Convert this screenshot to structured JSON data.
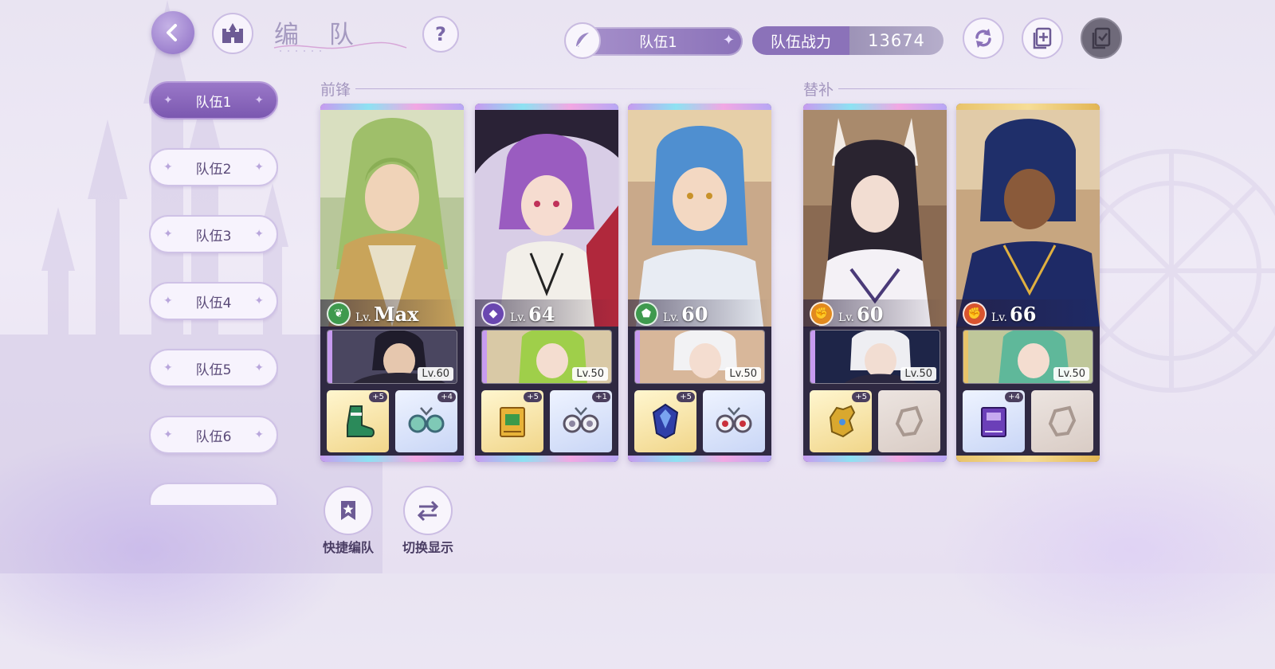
{
  "header": {
    "title": "编 队",
    "back_icon": "back-arrow-icon",
    "home_icon": "castle-icon",
    "help_label": "?",
    "team_select_label": "队伍1",
    "power_label": "队伍战力",
    "power_value": "13674"
  },
  "teams": [
    {
      "label": "队伍1",
      "active": true
    },
    {
      "label": "队伍2",
      "active": false
    },
    {
      "label": "队伍3",
      "active": false
    },
    {
      "label": "队伍4",
      "active": false
    },
    {
      "label": "队伍5",
      "active": false
    },
    {
      "label": "队伍6",
      "active": false
    }
  ],
  "sections": {
    "front": "前锋",
    "reserve": "替补"
  },
  "cards": [
    {
      "level_prefix": "Lv.",
      "level": "Max",
      "element": "green",
      "sub_level": "Lv.60",
      "equip1_plus": "+5",
      "equip2_plus": "+4"
    },
    {
      "level_prefix": "Lv.",
      "level": "64",
      "element": "purple",
      "sub_level": "Lv.50",
      "equip1_plus": "+5",
      "equip2_plus": "+1"
    },
    {
      "level_prefix": "Lv.",
      "level": "60",
      "element": "green",
      "sub_level": "Lv.50",
      "equip1_plus": "+5",
      "equip2_plus": ""
    },
    {
      "level_prefix": "Lv.",
      "level": "60",
      "element": "orange",
      "sub_level": "Lv.50",
      "equip1_plus": "+5",
      "equip2_plus": ""
    },
    {
      "level_prefix": "Lv.",
      "level": "66",
      "element": "red",
      "sub_level": "Lv.50",
      "equip1_plus": "+4",
      "equip2_plus": ""
    }
  ],
  "bottom": {
    "quick_label": "快捷编队",
    "switch_label": "切换显示"
  },
  "colors": {
    "accent": "#8b72b9",
    "green": "#3f9a4e",
    "purple": "#6a47b0",
    "orange": "#e28a1f",
    "red": "#d9542f"
  }
}
